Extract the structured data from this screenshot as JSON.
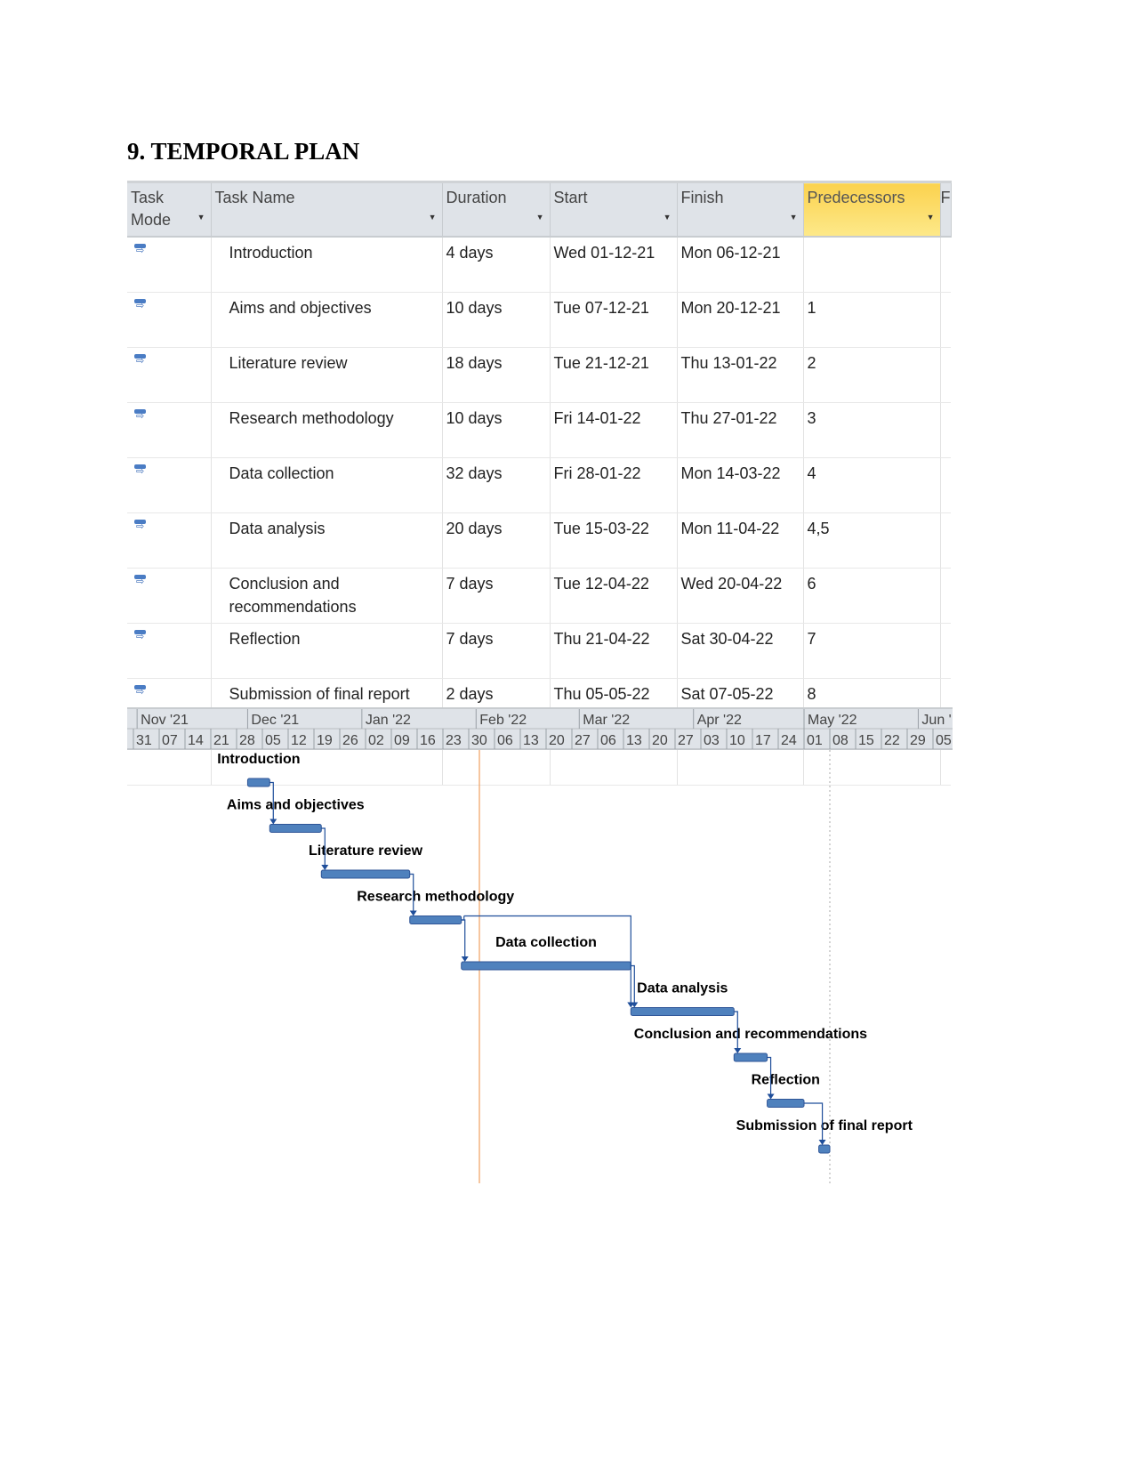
{
  "heading": "9. TEMPORAL PLAN",
  "columns": {
    "mode": "Task Mode",
    "name": "Task Name",
    "duration": "Duration",
    "start": "Start",
    "finish": "Finish",
    "predecessors": "Predecessors",
    "partial": "F"
  },
  "tasks": [
    {
      "id": 1,
      "name": "Introduction",
      "duration": "4 days",
      "start": "Wed 01-12-21",
      "finish": "Mon 06-12-21",
      "predecessors": ""
    },
    {
      "id": 2,
      "name": "Aims and objectives",
      "duration": "10 days",
      "start": "Tue 07-12-21",
      "finish": "Mon 20-12-21",
      "predecessors": "1"
    },
    {
      "id": 3,
      "name": "Literature review",
      "duration": "18 days",
      "start": "Tue 21-12-21",
      "finish": "Thu 13-01-22",
      "predecessors": "2"
    },
    {
      "id": 4,
      "name": "Research methodology",
      "duration": "10 days",
      "start": "Fri 14-01-22",
      "finish": "Thu 27-01-22",
      "predecessors": "3"
    },
    {
      "id": 5,
      "name": "Data collection",
      "duration": "32 days",
      "start": "Fri 28-01-22",
      "finish": "Mon 14-03-22",
      "predecessors": "4"
    },
    {
      "id": 6,
      "name": "Data analysis",
      "duration": "20 days",
      "start": "Tue 15-03-22",
      "finish": "Mon 11-04-22",
      "predecessors": "4,5"
    },
    {
      "id": 7,
      "name": "Conclusion and recommendations",
      "duration": "7 days",
      "start": "Tue 12-04-22",
      "finish": "Wed 20-04-22",
      "predecessors": "6"
    },
    {
      "id": 8,
      "name": "Reflection",
      "duration": "7 days",
      "start": "Thu 21-04-22",
      "finish": "Sat 30-04-22",
      "predecessors": "7"
    },
    {
      "id": 9,
      "name": "Submission of final report",
      "duration": "2 days",
      "start": "Thu 05-05-22",
      "finish": "Sat 07-05-22",
      "predecessors": "8"
    }
  ],
  "timescale": {
    "months": [
      "Nov '21",
      "Dec '21",
      "Jan '22",
      "Feb '22",
      "Mar '22",
      "Apr '22",
      "May '22",
      "Jun '"
    ],
    "weeks": [
      "31",
      "07",
      "14",
      "21",
      "28",
      "05",
      "12",
      "19",
      "26",
      "02",
      "09",
      "16",
      "23",
      "30",
      "06",
      "13",
      "20",
      "27",
      "06",
      "13",
      "20",
      "27",
      "03",
      "10",
      "17",
      "24",
      "01",
      "08",
      "15",
      "22",
      "29",
      "05"
    ]
  },
  "colors": {
    "bar": "#4f81bd",
    "bar_border": "#2f5597",
    "link": "#1f4e9a",
    "today_line": "#f0a060",
    "header_bg": "#dfe3e8",
    "pred_header": "#fbd24e"
  }
}
